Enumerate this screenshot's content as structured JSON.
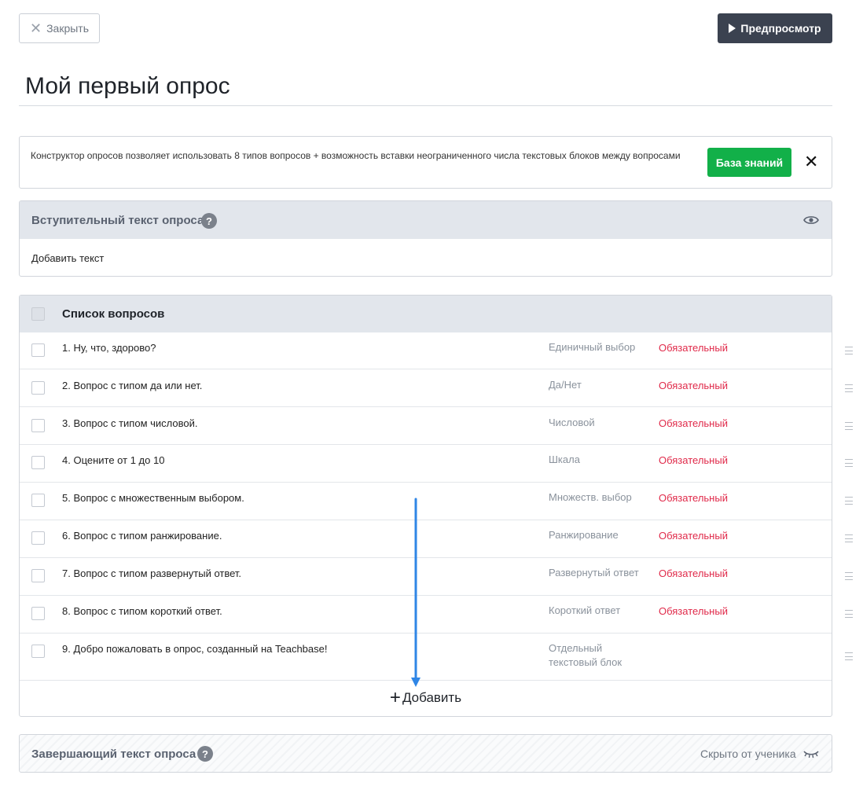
{
  "toolbar": {
    "close_label": "Закрыть",
    "preview_label": "Предпросмотр"
  },
  "page": {
    "title": "Мой первый опрос"
  },
  "info": {
    "text": "Конструктор опросов позволяет использовать 8 типов вопросов + возможность вставки неограниченного числа текстовых блоков между вопросами",
    "kb_button": "База знаний"
  },
  "intro": {
    "title": "Вступительный текст опроса",
    "add_text": "Добавить текст"
  },
  "questions": {
    "header": "Список вопросов",
    "items": [
      {
        "text": "1. Ну, что, здорово?",
        "type": "Единичный выбор",
        "required": "Обязательный"
      },
      {
        "text": "2. Вопрос с типом да или нет.",
        "type": "Да/Нет",
        "required": "Обязательный"
      },
      {
        "text": "3. Вопрос с типом числовой.",
        "type": "Числовой",
        "required": "Обязательный"
      },
      {
        "text": "4. Оцените от 1 до 10",
        "type": "Шкала",
        "required": "Обязательный"
      },
      {
        "text": "5. Вопрос с множественным выбором.",
        "type": "Множеств. выбор",
        "required": "Обязательный"
      },
      {
        "text": "6. Вопрос с типом ранжирование.",
        "type": "Ранжирование",
        "required": "Обязательный"
      },
      {
        "text": "7. Вопрос с типом развернутый ответ.",
        "type": "Развернутый ответ",
        "required": "Обязательный"
      },
      {
        "text": "8. Вопрос с типом короткий ответ.",
        "type": "Короткий ответ",
        "required": "Обязательный"
      },
      {
        "text": "9. Добро пожаловать в опрос, созданный на Teachbase!",
        "type_line1": "Отдельный",
        "type_line2": "текстовый блок"
      }
    ],
    "add_label": "Добавить"
  },
  "final": {
    "title": "Завершающий текст опроса",
    "hidden_label": "Скрыто от ученика"
  },
  "colors": {
    "accent_dark": "#3b4250",
    "green": "#12b049",
    "required_red": "#e02a4a",
    "arrow_blue": "#2f86e6"
  }
}
